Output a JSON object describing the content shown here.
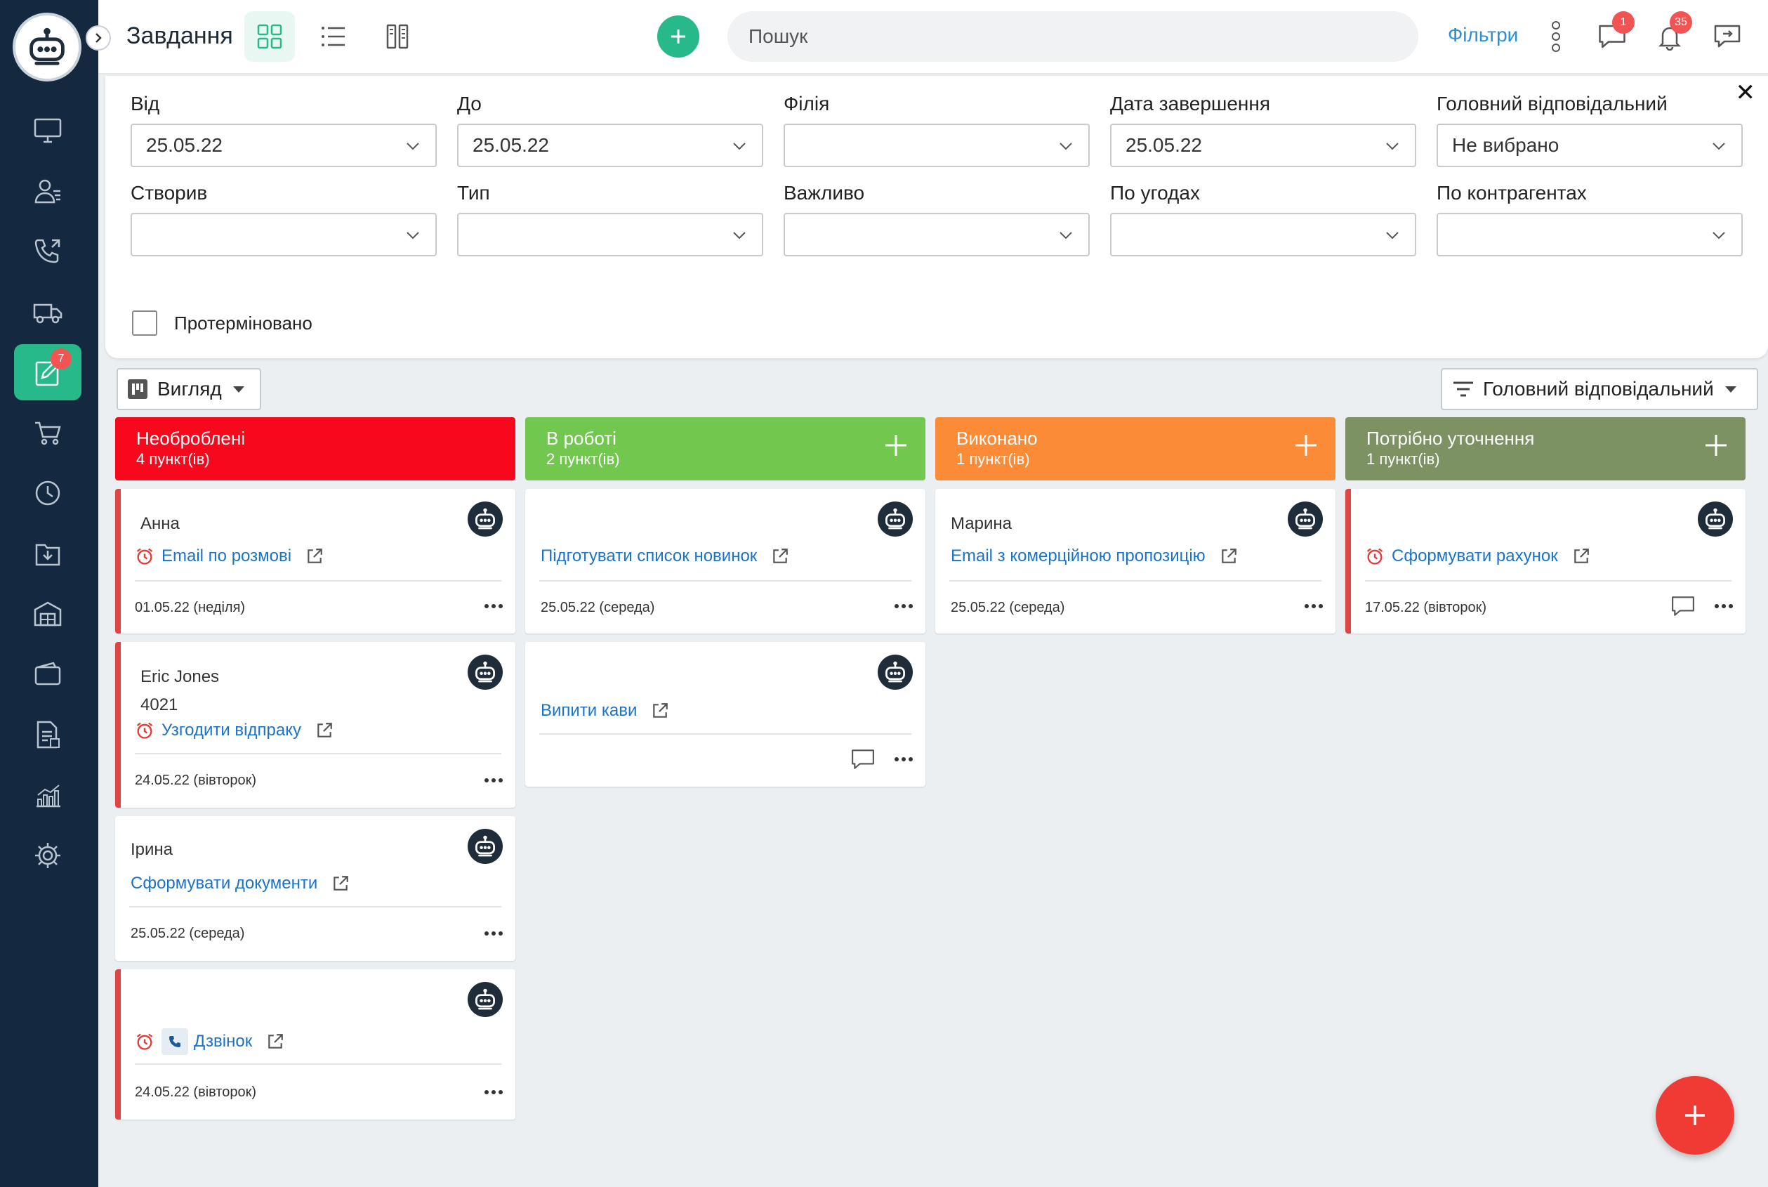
{
  "header": {
    "title": "Завдання",
    "search_placeholder": "Пошук",
    "filters_label": "Фільтри",
    "chat_badge": "1",
    "notif_badge": "35"
  },
  "sidebar": {
    "tasks_badge": "7"
  },
  "filters": {
    "from_label": "Від",
    "from_value": "25.05.22",
    "to_label": "До",
    "to_value": "25.05.22",
    "branch_label": "Філія",
    "branch_value": "",
    "end_date_label": "Дата завершення",
    "end_date_value": "25.05.22",
    "main_resp_label": "Головний відповідальний",
    "main_resp_value": "Не вибрано",
    "created_label": "Створив",
    "created_value": "",
    "type_label": "Тип",
    "type_value": "",
    "important_label": "Важливо",
    "important_value": "",
    "deals_label": "По угодах",
    "deals_value": "",
    "contractors_label": "По контрагентах",
    "contractors_value": "",
    "overdue_label": "Протерміновано"
  },
  "toolbar": {
    "view_label": "Вигляд",
    "group_label": "Головний відповідальний"
  },
  "columns": [
    {
      "name": "Необроблені",
      "count": "4 пункт(ів)",
      "color": "#f8081c"
    },
    {
      "name": "В роботі",
      "count": "2 пункт(ів)",
      "color": "#72c84e"
    },
    {
      "name": "Виконано",
      "count": "1 пункт(ів)",
      "color": "#fb8b36"
    },
    {
      "name": "Потрібно уточнення",
      "count": "1 пункт(ів)",
      "color": "#7d9262"
    }
  ],
  "cards": {
    "c0_0": {
      "contact": "Анна",
      "title": "Email по розмові",
      "date": "01.05.22 (неділя)"
    },
    "c0_1": {
      "contact": "Eric Jones",
      "extra": "4021",
      "title": "Узгодити відпраку",
      "date": "24.05.22 (вівторок)"
    },
    "c0_2": {
      "contact": "Ірина",
      "title": "Сформувати документи",
      "date": "25.05.22 (середа)"
    },
    "c0_3": {
      "title": "Дзвінок",
      "date": "24.05.22 (вівторок)"
    },
    "c1_0": {
      "title": "Підготувати список новинок",
      "date": "25.05.22 (середа)"
    },
    "c1_1": {
      "title": "Випити кави"
    },
    "c2_0": {
      "contact": "Марина",
      "title": "Email з комерційною пропозицію",
      "date": "25.05.22 (середа)"
    },
    "c3_0": {
      "title": "Сформувати рахунок",
      "date": "17.05.22 (вівторок)"
    }
  }
}
